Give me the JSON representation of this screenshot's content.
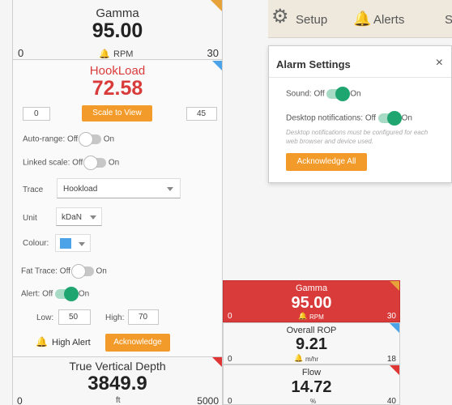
{
  "gamma_top": {
    "name": "Gamma",
    "value": "95.00",
    "unit": "RPM",
    "min": "0",
    "max": "30"
  },
  "hookload": {
    "name": "HookLoad",
    "value": "72.58",
    "min_input": "0",
    "max_input": "45",
    "scale_button": "Scale to View",
    "auto_range_label": "Auto-range:",
    "auto_range_off": "Off",
    "auto_range_on": "On",
    "linked_label": "Linked scale:",
    "linked_off": "Off",
    "linked_on": "On",
    "trace_label": "Trace",
    "trace_value": "Hookload",
    "unit_label": "Unit",
    "unit_value": "kDaN",
    "colour_label": "Colour:",
    "colour": "#4da3e8",
    "fat_label": "Fat Trace:",
    "fat_off": "Off",
    "fat_on": "On",
    "alert_label": "Alert:",
    "alert_off": "Off",
    "alert_on": "On",
    "low_label": "Low:",
    "low_value": "50",
    "high_label": "High:",
    "high_value": "70",
    "high_alert": "High Alert",
    "acknowledge": "Acknowledge"
  },
  "tvd": {
    "name": "True Vertical Depth",
    "value": "3849.9",
    "unit": "ft",
    "min": "0",
    "max": "5000"
  },
  "toolbar": {
    "setup": "Setup",
    "alerts": "Alerts",
    "partial": "S"
  },
  "alarm": {
    "title": "Alarm Settings",
    "close": "×",
    "sound_label": "Sound:",
    "sound_off": "Off",
    "sound_on": "On",
    "desktop_label": "Desktop notifications:",
    "desktop_off": "Off",
    "desktop_on": "On",
    "note": "Desktop notifications must be configured for each web browser and device used.",
    "ack_all": "Acknowledge All"
  },
  "gamma_red": {
    "name": "Gamma",
    "value": "95.00",
    "unit": "RPM",
    "min": "0",
    "max": "30"
  },
  "rop": {
    "name": "Overall ROP",
    "value": "9.21",
    "unit": "m/hr",
    "min": "0",
    "max": "18"
  },
  "flow": {
    "name": "Flow",
    "value": "14.72",
    "unit": "%",
    "min": "0",
    "max": "40"
  },
  "colors": {
    "alert_red": "#d93b3b",
    "accent_orange": "#f39b2a",
    "toggle_green": "#1fa56f",
    "corner_blue": "#4da3e8",
    "corner_red": "#e03535",
    "corner_yellow": "#e8a23a"
  }
}
